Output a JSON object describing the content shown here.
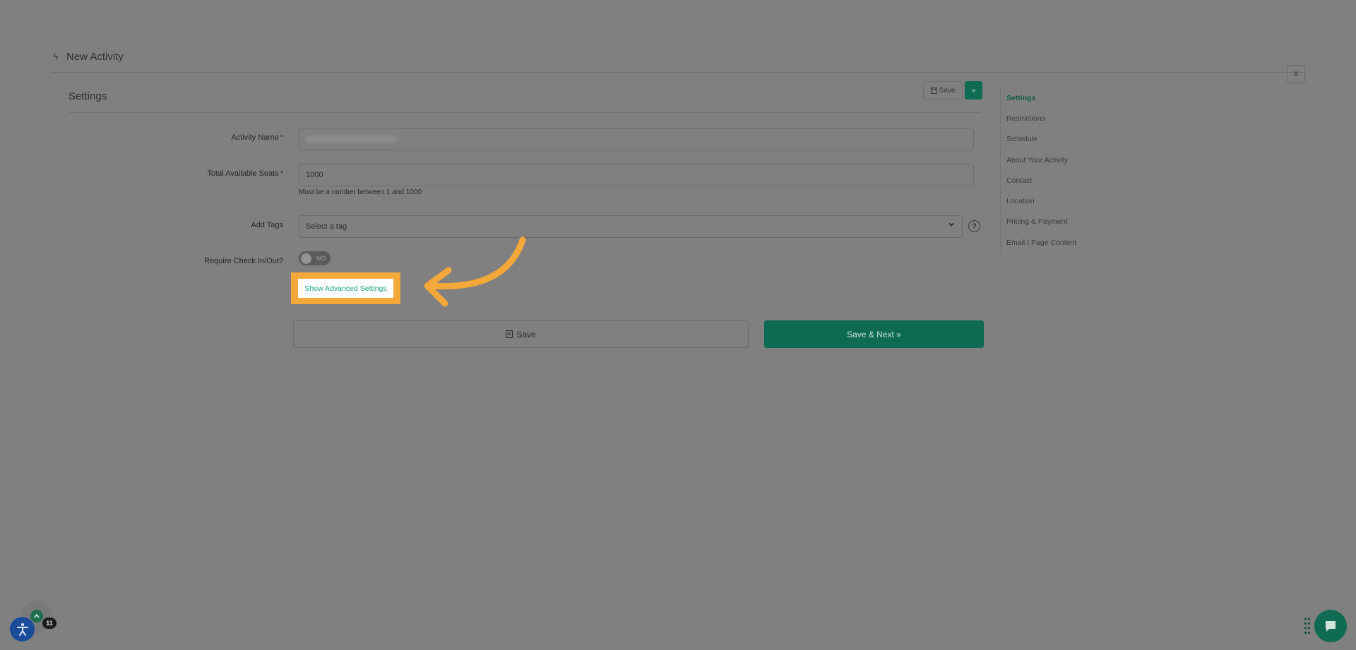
{
  "header": {
    "title": "New Activity",
    "close_label": "X"
  },
  "card": {
    "title": "Settings",
    "top_save_label": "Save",
    "top_next_label": "»"
  },
  "form": {
    "activity_name": {
      "label": "Activity Name",
      "required_mark": "*"
    },
    "seats": {
      "label": "Total Available Seats",
      "required_mark": "*",
      "value": "1000",
      "helper": "Must be a number between 1 and 1000"
    },
    "tags": {
      "label": "Add Tags",
      "placeholder": "Select a tag",
      "help_symbol": "?"
    },
    "checkin": {
      "label": "Require Check In/Out?",
      "toggle_text": "NO"
    },
    "advanced_link": "Show Advanced Settings"
  },
  "footer": {
    "save_label": "Save",
    "save_next_label": "Save & Next »"
  },
  "side_nav": {
    "items": [
      {
        "label": "Settings"
      },
      {
        "label": "Restrictions"
      },
      {
        "label": "Schedule"
      },
      {
        "label": "About Your Activity"
      },
      {
        "label": "Contact"
      },
      {
        "label": "Location"
      },
      {
        "label": "Pricing & Payment"
      },
      {
        "label": "Email / Page Content"
      }
    ]
  },
  "widgets": {
    "notification_count": "11"
  },
  "colors": {
    "overlay": "#808080",
    "primary": "#0f6b52",
    "highlight": "#f5a83a",
    "link": "#1aa37c",
    "accessibility": "#1b4c9a"
  },
  "icons": {
    "header": "bolt-icon",
    "save": "floppy-icon",
    "caret": "chevron-down-icon",
    "help": "question-circle-icon",
    "accessibility": "accessibility-icon",
    "chat": "chat-bubble-icon",
    "annotation": "curved-arrow-icon"
  }
}
